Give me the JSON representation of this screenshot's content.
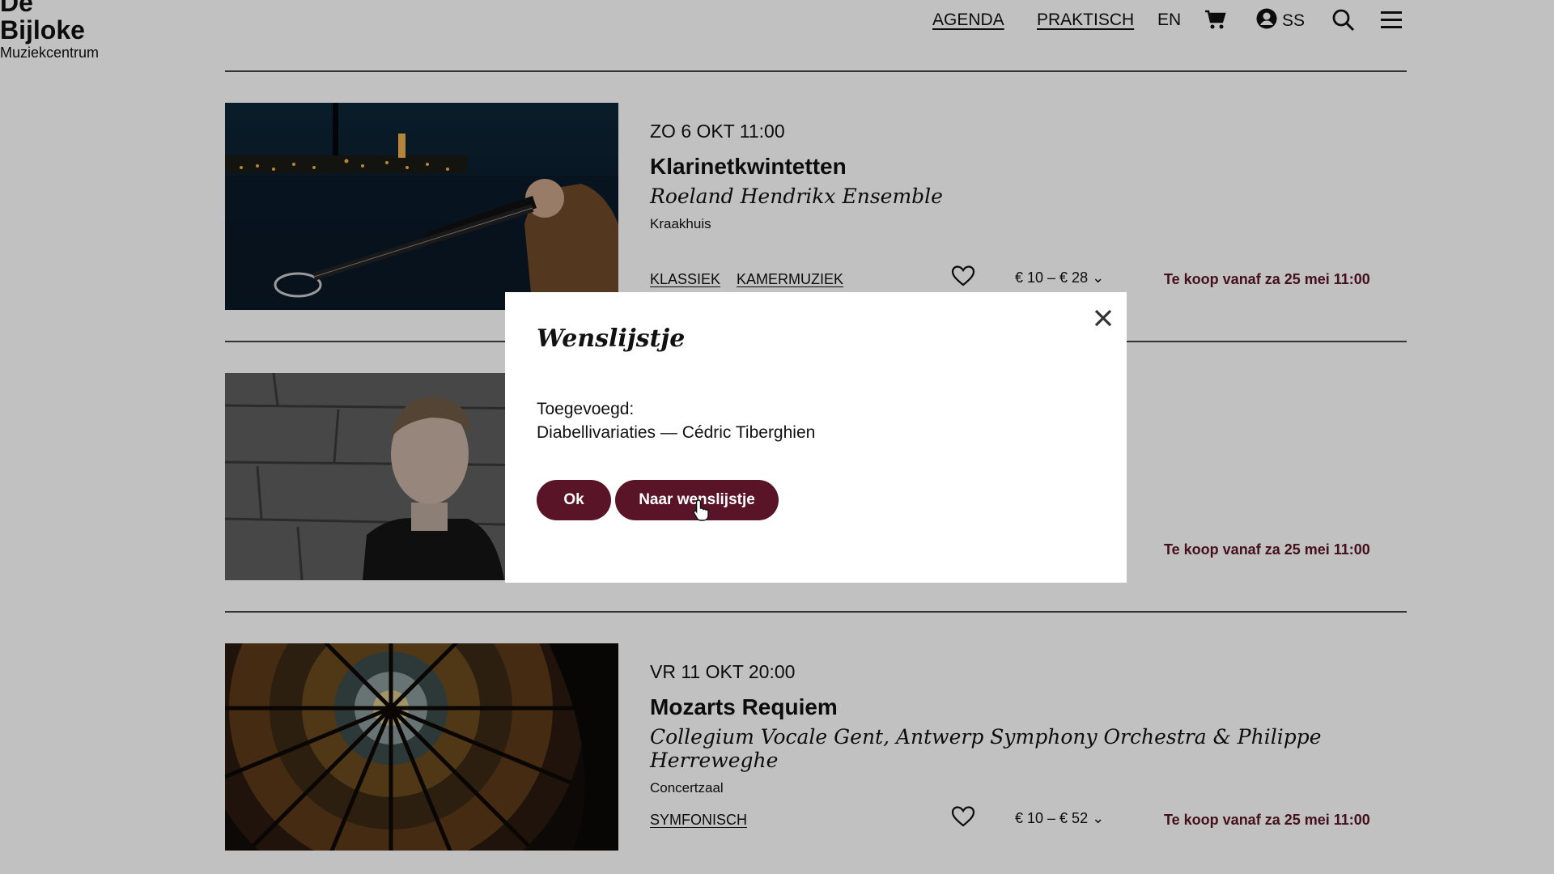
{
  "header": {
    "logo": {
      "line1": "De",
      "line2": "Bijloke",
      "line3": "Muziekcentrum"
    },
    "nav": {
      "agenda": "AGENDA",
      "praktisch": "PRAKTISCH",
      "language": "EN",
      "user_initials": "SS"
    }
  },
  "events": [
    {
      "date": "ZO 6 OKT 11:00",
      "title": "Klarinetkwintetten",
      "performer": "Roeland Hendrikx Ensemble",
      "venue": "Kraakhuis",
      "tags": [
        "KLASSIEK",
        "KAMERMUZIEK"
      ],
      "price": "€ 10 – € 28",
      "sale": "Te koop vanaf za 25 mei 11:00"
    },
    {
      "sale": "Te koop vanaf za 25 mei 11:00"
    },
    {
      "date": "VR 11 OKT 20:00",
      "title": "Mozarts Requiem",
      "performer": "Collegium Vocale Gent, Antwerp Symphony Orchestra & Philippe Herreweghe",
      "venue": "Concertzaal",
      "tags": [
        "SYMFONISCH"
      ],
      "price": "€ 10 – € 52",
      "sale": "Te koop vanaf za 25 mei 11:00"
    }
  ],
  "modal": {
    "title": "Wenslijstje",
    "added_label": "Toegevoegd:",
    "added_item": "Diabellivariaties — Cédric Tiberghien",
    "ok_label": "Ok",
    "wishlist_label": "Naar wenslijstje"
  },
  "colors": {
    "accent": "#5a1428",
    "overlay": "rgba(0,0,0,0.245)"
  }
}
